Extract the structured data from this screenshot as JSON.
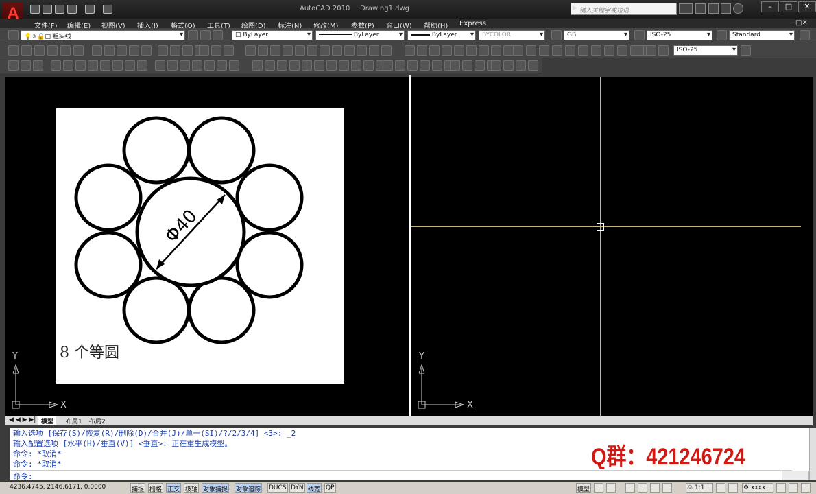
{
  "title": {
    "app": "AutoCAD 2010",
    "document": "Drawing1.dwg",
    "logo": "A"
  },
  "search": {
    "placeholder": "键入关键字或短语"
  },
  "window_controls": [
    "–",
    "□",
    "✕"
  ],
  "menu": [
    "文件(F)",
    "编辑(E)",
    "视图(V)",
    "插入(I)",
    "格式(O)",
    "工具(T)",
    "绘图(D)",
    "标注(N)",
    "修改(M)",
    "参数(P)",
    "窗口(W)",
    "帮助(H)",
    "Express"
  ],
  "properties": {
    "layer": "粗实线",
    "color": "ByLayer",
    "linetype": "ByLayer",
    "lineweight": "ByLayer",
    "plotstyle": "BYCOLOR",
    "text_style": "GB",
    "dim_style": "ISO-25",
    "table_style": "Standard",
    "multileader_style": "ISO-25"
  },
  "drawing": {
    "dimension": "Φ40",
    "caption": "8 个等圆"
  },
  "ucs": {
    "x": "X",
    "y": "Y"
  },
  "tabs": [
    "模型",
    "布局1",
    "布局2"
  ],
  "command_lines": [
    "输入选项 [保存(S)/恢复(R)/删除(D)/合并(J)/单一(SI)/?/2/3/4] <3>: _2",
    "输入配置选项 [水平(H)/垂直(V)] <垂直>:  正在重生成模型。",
    "命令: *取消*",
    "命令: *取消*"
  ],
  "command_prompt": "命令:",
  "watermark": "Q群：421246724",
  "status": {
    "coords": "4236.4745, 2146.6171, 0.0000",
    "toggles": [
      {
        "label": "捕捉",
        "on": false
      },
      {
        "label": "栅格",
        "on": false
      },
      {
        "label": "正交",
        "on": true
      },
      {
        "label": "极轴",
        "on": false
      },
      {
        "label": "对象捕捉",
        "on": true
      },
      {
        "label": "对象追踪",
        "on": true
      },
      {
        "label": "DUCS",
        "on": false
      },
      {
        "label": "DYN",
        "on": false
      },
      {
        "label": "线宽",
        "on": true
      },
      {
        "label": "QP",
        "on": false
      }
    ],
    "model": "模型",
    "scale": "1:1",
    "workspace": "xxxx"
  },
  "colors": {
    "accent": "#d11a14",
    "command_text": "#1a3ea8",
    "crosshair": "#c8b47a"
  }
}
